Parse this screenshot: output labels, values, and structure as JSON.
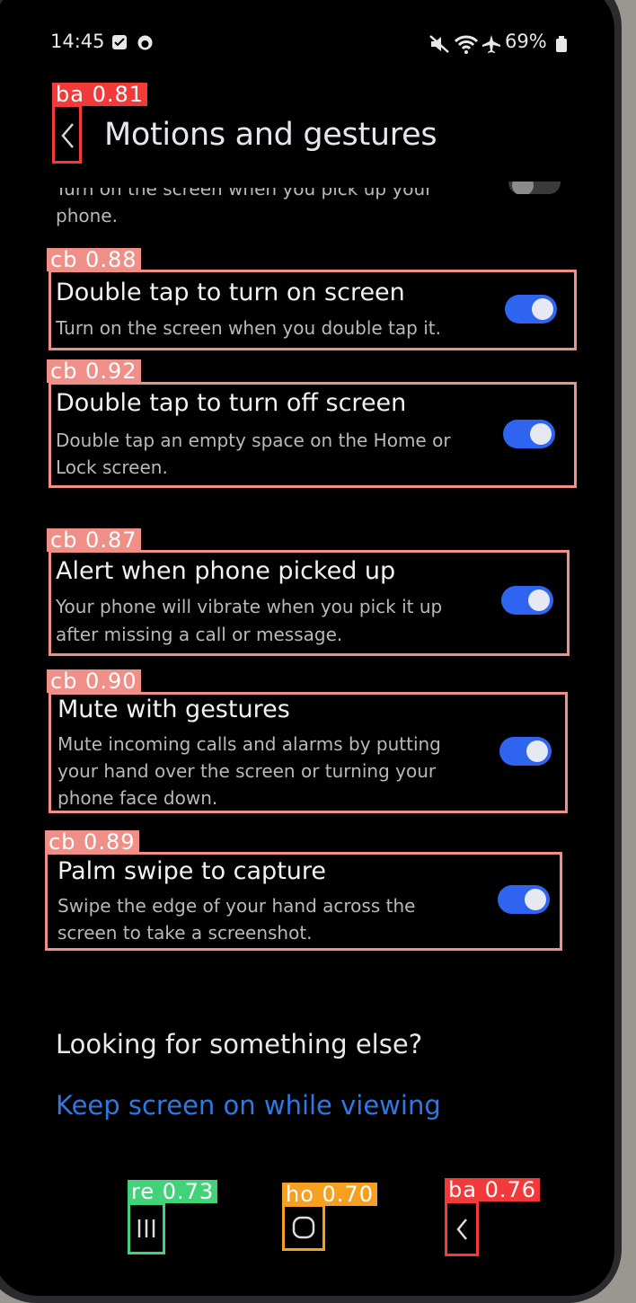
{
  "status_bar": {
    "time": "14:45",
    "battery": "69%",
    "icons": [
      "calendar-icon",
      "circle-icon",
      "mute-icon",
      "wifi-icon",
      "airplane-icon",
      "battery-icon"
    ]
  },
  "header": {
    "title": "Motions and gestures"
  },
  "partial_row": {
    "desc_line1": "Turn on the screen when you pick up your",
    "desc_line2": "phone."
  },
  "settings": [
    {
      "title": "Double tap to turn on screen",
      "desc": [
        "Turn on the screen when you double tap it."
      ],
      "on": true
    },
    {
      "title": "Double tap to turn off screen",
      "desc": [
        "Double tap an empty space on the Home or",
        "Lock screen."
      ],
      "on": true
    },
    {
      "title": "Alert when phone picked up",
      "desc": [
        "Your phone will vibrate when you pick it up",
        "after missing a call or message."
      ],
      "on": true
    },
    {
      "title": "Mute with gestures",
      "desc": [
        "Mute incoming calls and alarms by putting",
        "your hand over the screen or turning your",
        "phone face down."
      ],
      "on": true
    },
    {
      "title": "Palm swipe to capture",
      "desc": [
        "Swipe the edge of your hand across the",
        "screen to take a screenshot."
      ],
      "on": true
    }
  ],
  "suggestions": {
    "heading": "Looking for something else?",
    "link": "Keep screen on while viewing"
  },
  "detections": {
    "back_top": "ba 0.81",
    "row1": "cb 0.88",
    "row2": "cb 0.92",
    "row3": "cb 0.87",
    "row4": "cb 0.90",
    "row5": "cb 0.89",
    "recents": "re 0.73",
    "home": "ho 0.70",
    "back_nav": "ba 0.76"
  },
  "colors": {
    "accent": "#2e64ef",
    "link": "#2e78e6",
    "box_cb": "#ef8f88",
    "box_ba": "#f23a3a",
    "box_re": "#42d27a",
    "box_ho": "#f5a020"
  }
}
